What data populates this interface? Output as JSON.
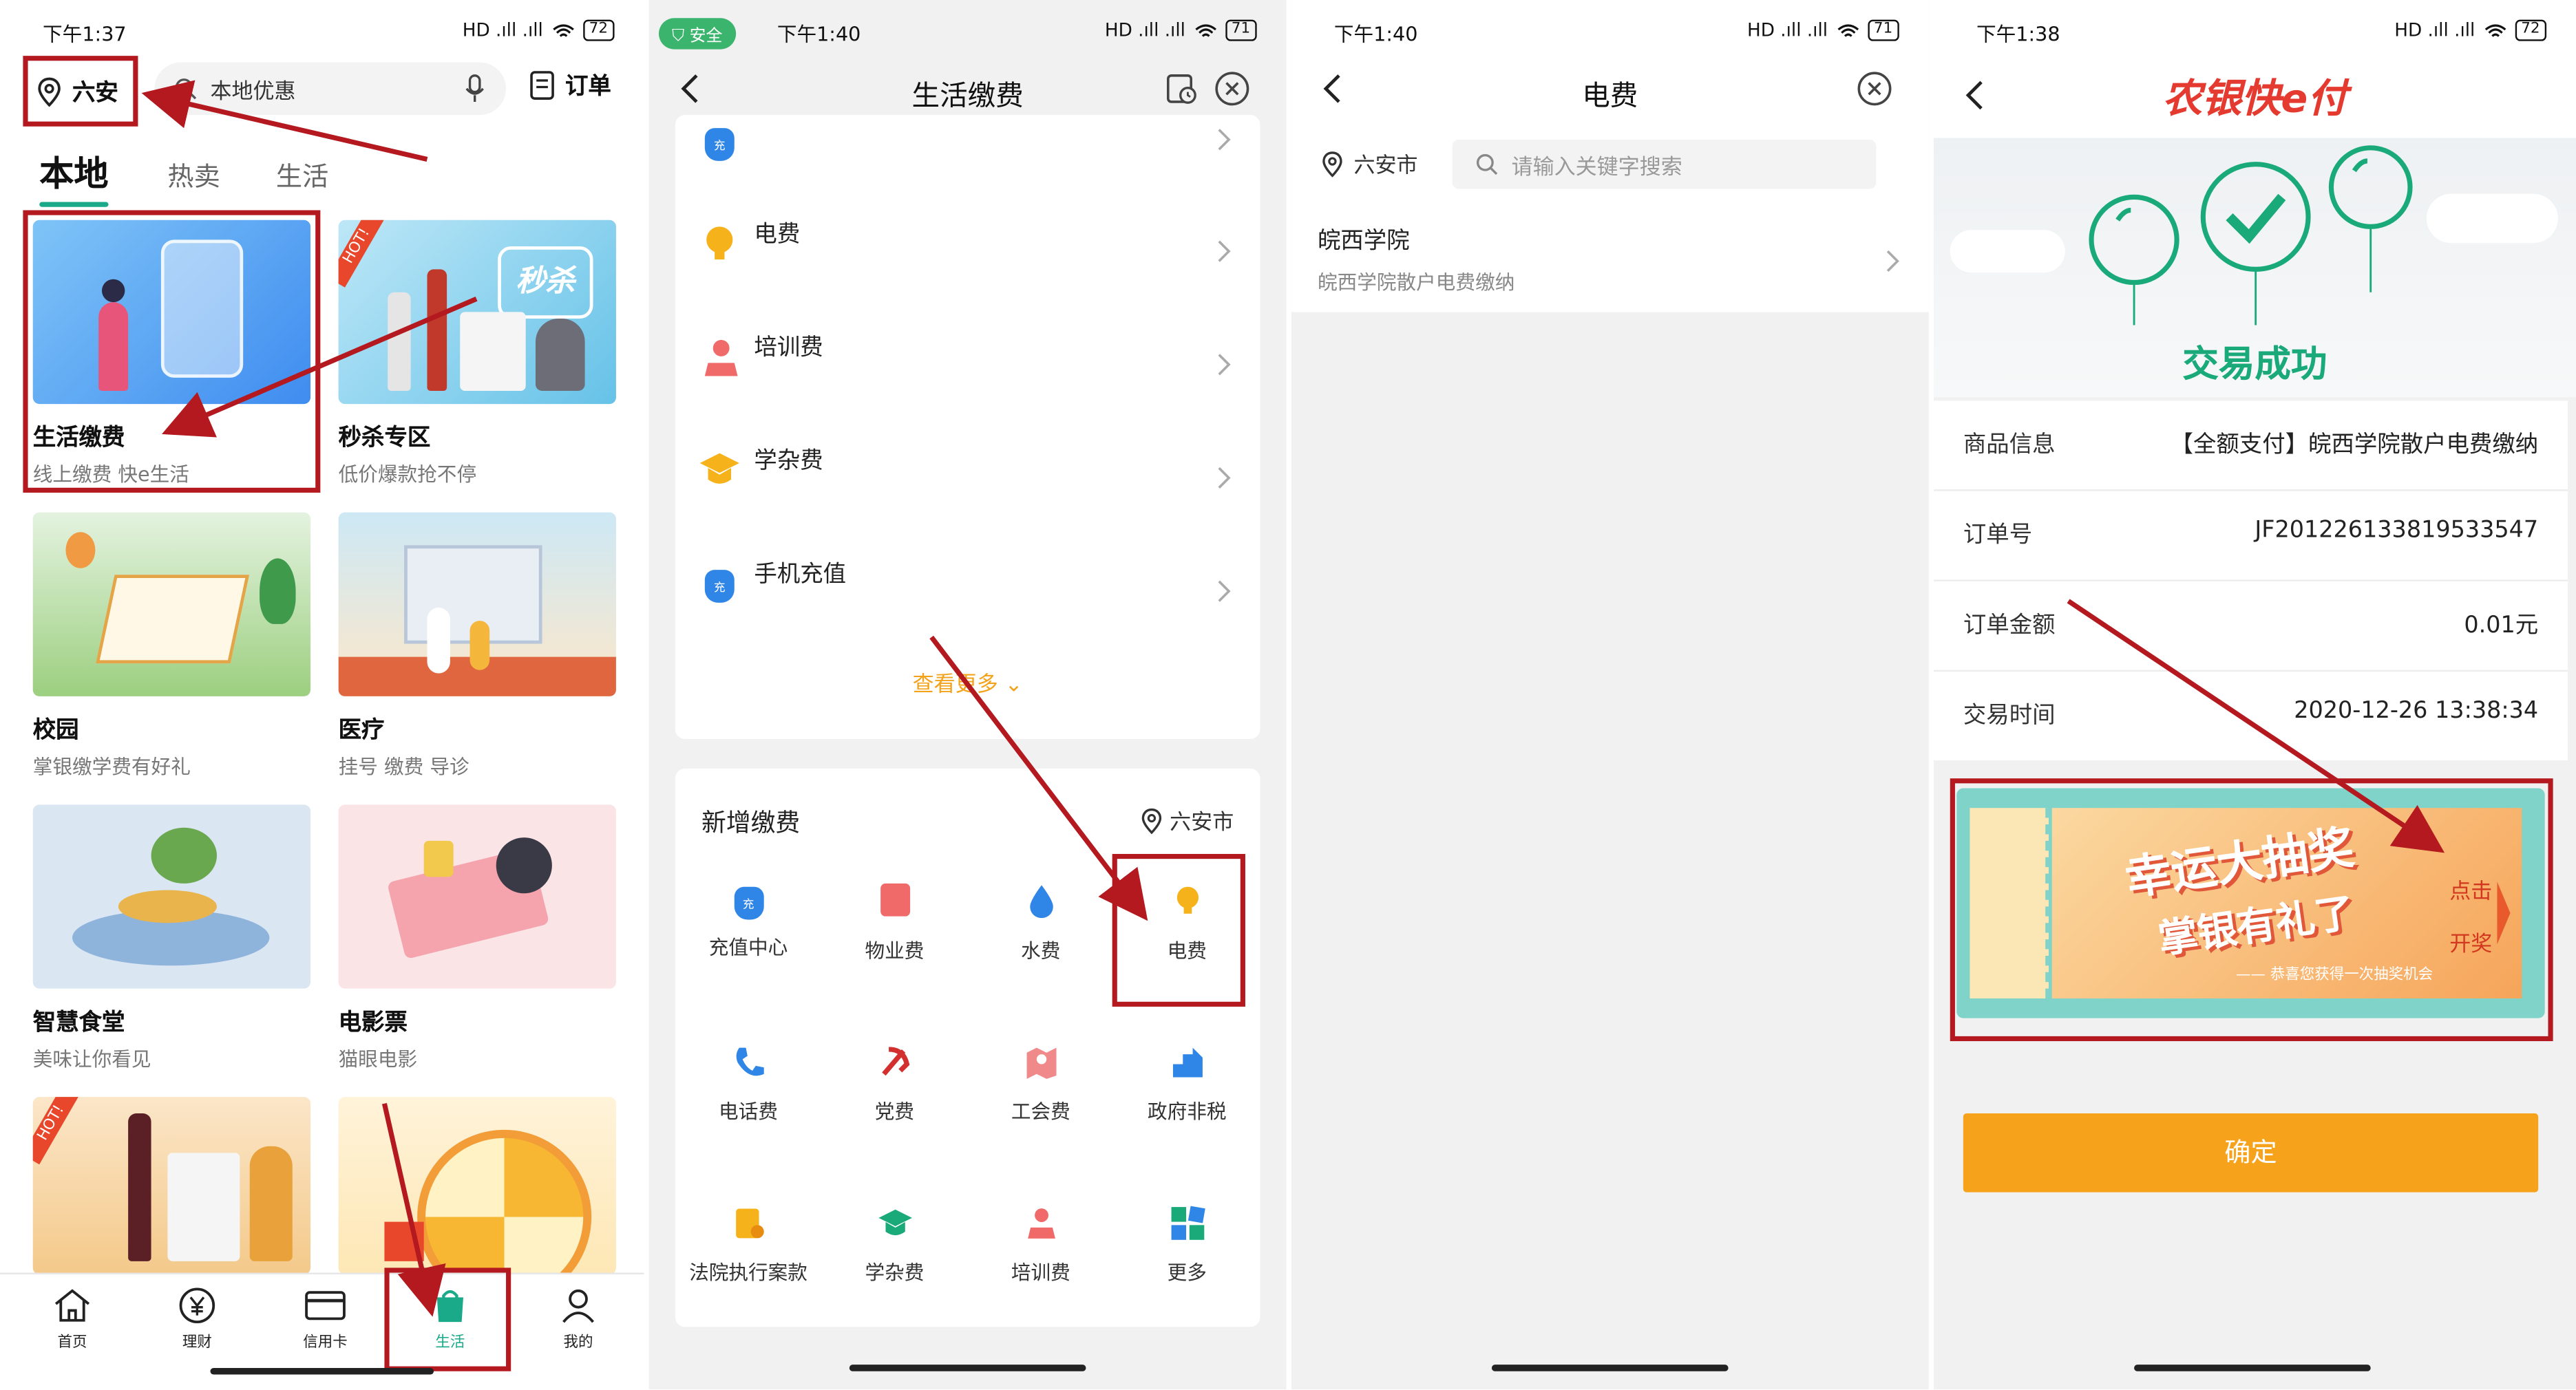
{
  "status_times": [
    "下午1:37",
    "下午1:40",
    "下午1:40",
    "下午1:38"
  ],
  "status_signal": "HD .ıll .ıll",
  "battery_levels": [
    "72",
    "71",
    "71",
    "72"
  ],
  "panel1": {
    "location": "六安",
    "search_placeholder": "本地优惠",
    "orders_label": "订单",
    "tabs": [
      "本地",
      "热卖",
      "生活"
    ],
    "cards": [
      {
        "title": "生活缴费",
        "subtitle": "线上缴费 快e生活"
      },
      {
        "title": "秒杀专区",
        "subtitle": "低价爆款抢不停"
      },
      {
        "title": "校园",
        "subtitle": "掌银缴学费有好礼"
      },
      {
        "title": "医疗",
        "subtitle": "挂号 缴费 导诊"
      },
      {
        "title": "智慧食堂",
        "subtitle": "美味让你看见"
      },
      {
        "title": "电影票",
        "subtitle": "猫眼电影"
      }
    ],
    "hot_badge": "HOT!",
    "miaosha_badge": "秒杀",
    "bottom_nav": [
      "首页",
      "理财",
      "信用卡",
      "生活",
      "我的"
    ]
  },
  "panel2": {
    "safe_badge": "安全",
    "title": "生活缴费",
    "list_items": [
      "电费",
      "培训费",
      "学杂费",
      "手机充值"
    ],
    "see_more": "查看更多",
    "new_section_title": "新增缴费",
    "new_section_location": "六安市",
    "grid_items": [
      "充值中心",
      "物业费",
      "水费",
      "电费",
      "电话费",
      "党费",
      "工会费",
      "政府非税",
      "法院执行案款",
      "学杂费",
      "培训费",
      "更多"
    ],
    "charge_glyph": "充"
  },
  "panel3": {
    "title": "电费",
    "location": "六安市",
    "search_placeholder": "请输入关键字搜索",
    "result_title": "皖西学院",
    "result_subtitle": "皖西学院散户电费缴纳"
  },
  "panel4": {
    "brand": "农银快e付",
    "success_text": "交易成功",
    "rows": [
      {
        "label": "商品信息",
        "value": "【全额支付】皖西学院散户电费缴纳"
      },
      {
        "label": "订单号",
        "value": "JF201226133819533547"
      },
      {
        "label": "订单金额",
        "value": "0.01元"
      },
      {
        "label": "交易时间",
        "value": "2020-12-26 13:38:34"
      }
    ],
    "lottery_title": "幸运大抽奖",
    "lottery_subtitle": "掌银有礼了",
    "lottery_tagline": "—— 恭喜您获得一次抽奖机会",
    "lottery_click": "点击",
    "lottery_open": "开奖",
    "confirm_label": "确定"
  },
  "colors": {
    "accent_green": "#1aaa8a",
    "annotation_red": "#b3191e",
    "confirm_orange": "#f7a21b",
    "success_green": "#1aaa7a",
    "brand_red": "#e43a2f"
  }
}
